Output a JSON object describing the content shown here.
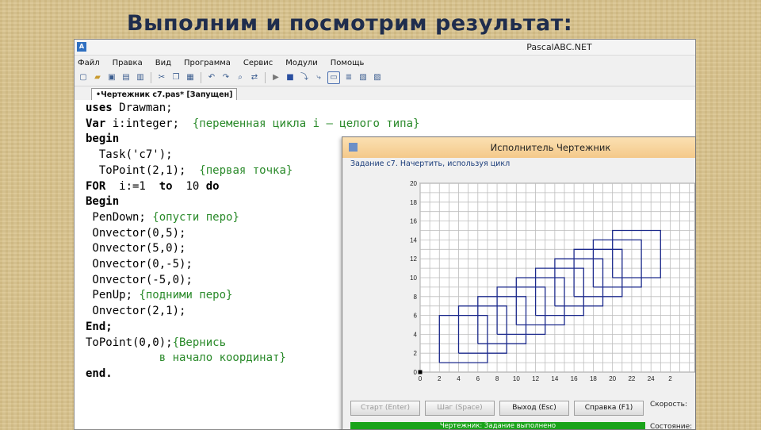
{
  "slide": {
    "title": "Выполним и посмотрим результат:"
  },
  "ide": {
    "title": "PascalABC.NET",
    "menu": [
      "Файл",
      "Правка",
      "Вид",
      "Программа",
      "Сервис",
      "Модули",
      "Помощь"
    ],
    "tab": "•Чертежник c7.pas* [Запущен]"
  },
  "code": [
    [
      {
        "t": "uses Drawman;",
        "c": "kw-part"
      }
    ],
    [
      {
        "t": "Var ",
        "c": "kw"
      },
      {
        "t": "i:integer;  ",
        "c": ""
      },
      {
        "t": "{переменная цикла i – целого типа}",
        "c": "cm"
      }
    ],
    [
      {
        "t": "begin",
        "c": "kw"
      }
    ],
    [
      {
        "t": "  Task('c7');",
        "c": ""
      }
    ],
    [
      {
        "t": "  ToPoint(2,1);  ",
        "c": ""
      },
      {
        "t": "{первая точка}",
        "c": "cm"
      }
    ],
    [
      {
        "t": "FOR ",
        "c": "kw"
      },
      {
        "t": " i:=1  ",
        "c": ""
      },
      {
        "t": "to",
        "c": "kw"
      },
      {
        "t": "  10 ",
        "c": ""
      },
      {
        "t": "do",
        "c": "kw"
      }
    ],
    [
      {
        "t": "Begin",
        "c": "kw"
      }
    ],
    [
      {
        "t": " PenDown; ",
        "c": ""
      },
      {
        "t": "{опусти перо}",
        "c": "cm"
      }
    ],
    [
      {
        "t": " Onvector(0,5);",
        "c": ""
      }
    ],
    [
      {
        "t": " Onvector(5,0);",
        "c": ""
      }
    ],
    [
      {
        "t": " Onvector(0,-5);",
        "c": ""
      }
    ],
    [
      {
        "t": " Onvector(-5,0);",
        "c": ""
      }
    ],
    [
      {
        "t": " PenUp; ",
        "c": ""
      },
      {
        "t": "{подними перо}",
        "c": "cm"
      }
    ],
    [
      {
        "t": " Onvector(2,1);",
        "c": ""
      }
    ],
    [
      {
        "t": "End;",
        "c": "kw"
      }
    ],
    [
      {
        "t": "ToPoint(0,0);",
        "c": ""
      },
      {
        "t": "{Вернись",
        "c": "cm"
      }
    ],
    [
      {
        "t": "           в начало координат}",
        "c": "cm"
      }
    ],
    [
      {
        "t": "end.",
        "c": "kw"
      }
    ]
  ],
  "robot": {
    "title": "Исполнитель Чертежник",
    "task": "Задание c7. Начертить, используя цикл",
    "buttons": [
      {
        "label": "Старт (Enter)",
        "enabled": false
      },
      {
        "label": "Шаг (Space)",
        "enabled": false
      },
      {
        "label": "Выход (Esc)",
        "enabled": true
      },
      {
        "label": "Справка (F1)",
        "enabled": true
      }
    ],
    "speed_label": "Скорость:",
    "state_label": "Состояние:",
    "status_text": "Чертежник: Задание выполнено"
  },
  "chart_data": {
    "type": "line",
    "xlim": [
      0,
      28
    ],
    "ylim": [
      0,
      20
    ],
    "x_ticks": [
      0,
      2,
      4,
      6,
      8,
      10,
      12,
      14,
      16,
      18,
      20,
      22,
      24,
      26,
      28
    ],
    "y_ticks": [
      0,
      2,
      4,
      6,
      8,
      10,
      12,
      14,
      16,
      18,
      20
    ],
    "x_tick_labels": [
      "0",
      "2",
      "4",
      "6",
      "8",
      "10",
      "12",
      "14",
      "16",
      "18",
      "20",
      "22",
      "24",
      "2"
    ],
    "grid": true,
    "series": [
      {
        "values": [
          [
            2,
            1
          ],
          [
            2,
            6
          ],
          [
            7,
            6
          ],
          [
            7,
            1
          ],
          [
            2,
            1
          ]
        ]
      },
      {
        "values": [
          [
            4,
            2
          ],
          [
            4,
            7
          ],
          [
            9,
            7
          ],
          [
            9,
            2
          ],
          [
            4,
            2
          ]
        ]
      },
      {
        "values": [
          [
            6,
            3
          ],
          [
            6,
            8
          ],
          [
            11,
            8
          ],
          [
            11,
            3
          ],
          [
            6,
            3
          ]
        ]
      },
      {
        "values": [
          [
            8,
            4
          ],
          [
            8,
            9
          ],
          [
            13,
            9
          ],
          [
            13,
            4
          ],
          [
            8,
            4
          ]
        ]
      },
      {
        "values": [
          [
            10,
            5
          ],
          [
            10,
            10
          ],
          [
            15,
            10
          ],
          [
            15,
            5
          ],
          [
            10,
            5
          ]
        ]
      },
      {
        "values": [
          [
            12,
            6
          ],
          [
            12,
            11
          ],
          [
            17,
            11
          ],
          [
            17,
            6
          ],
          [
            12,
            6
          ]
        ]
      },
      {
        "values": [
          [
            14,
            7
          ],
          [
            14,
            12
          ],
          [
            19,
            12
          ],
          [
            19,
            7
          ],
          [
            14,
            7
          ]
        ]
      },
      {
        "values": [
          [
            16,
            8
          ],
          [
            16,
            13
          ],
          [
            21,
            13
          ],
          [
            21,
            8
          ],
          [
            16,
            8
          ]
        ]
      },
      {
        "values": [
          [
            18,
            9
          ],
          [
            18,
            14
          ],
          [
            23,
            14
          ],
          [
            23,
            9
          ],
          [
            18,
            9
          ]
        ]
      },
      {
        "values": [
          [
            20,
            10
          ],
          [
            20,
            15
          ],
          [
            25,
            15
          ],
          [
            25,
            10
          ],
          [
            20,
            10
          ]
        ]
      }
    ],
    "line_color": "#1c2a8c"
  }
}
